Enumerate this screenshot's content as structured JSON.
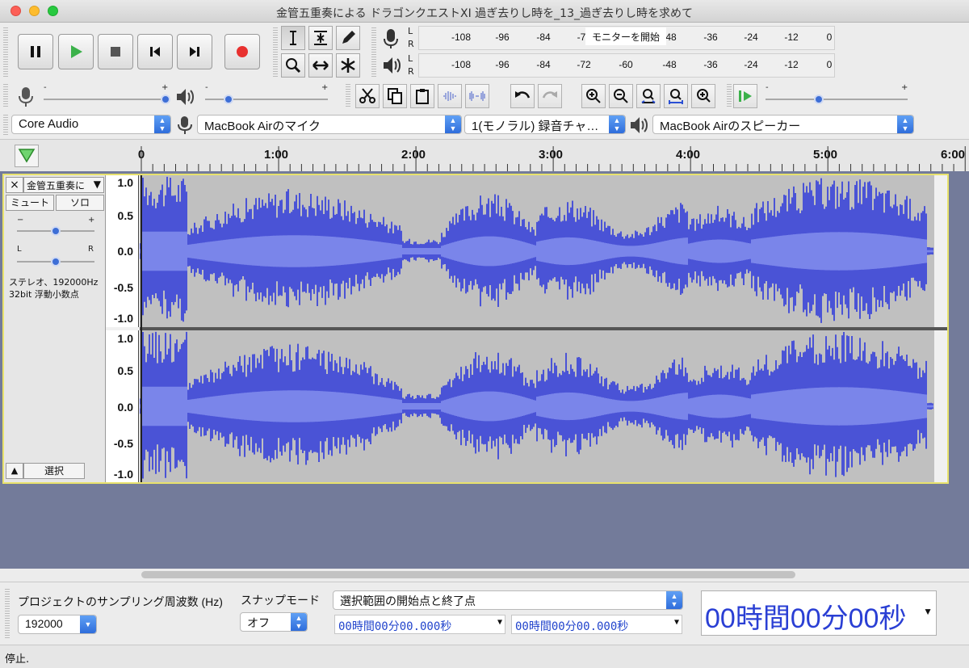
{
  "window": {
    "title": "金管五重奏による ドラゴンクエストXI 過ぎ去りし時を_13_過ぎ去りし時を求めて"
  },
  "transport": {
    "buttons": [
      {
        "id": "pause",
        "icon": "pause-icon"
      },
      {
        "id": "play",
        "icon": "play-icon"
      },
      {
        "id": "stop",
        "icon": "stop-icon"
      },
      {
        "id": "skip-start",
        "icon": "skip-to-start-icon"
      },
      {
        "id": "skip-end",
        "icon": "skip-to-end-icon"
      },
      {
        "id": "record",
        "icon": "record-icon"
      }
    ]
  },
  "meters": {
    "record": {
      "channels": [
        "L",
        "R"
      ],
      "ticks": [
        "-108",
        "-96",
        "-84",
        "-7",
        "-48",
        "-36",
        "-24",
        "-12",
        "0"
      ],
      "hint": "モニターを開始"
    },
    "playback": {
      "channels": [
        "L",
        "R"
      ],
      "ticks": [
        "-108",
        "-96",
        "-84",
        "-72",
        "-60",
        "-48",
        "-36",
        "-24",
        "-12",
        "0"
      ]
    }
  },
  "mixer": {
    "minus": "-",
    "plus": "+",
    "record_volume": 1.0,
    "playback_volume": 0.2
  },
  "play_at_speed": {
    "minus": "-",
    "plus": "+",
    "speed_position": 0.38
  },
  "devices": {
    "host": "Core Audio",
    "input": "MacBook Airのマイク",
    "channels": "1(モノラル) 録音チャ…",
    "output": "MacBook Airのスピーカー"
  },
  "timeline": {
    "labels": [
      "0",
      "1:00",
      "2:00",
      "3:00",
      "4:00",
      "5:00",
      "6:00"
    ]
  },
  "track": {
    "name": "金管五重奏に",
    "close": "×",
    "mute": "ミュート",
    "solo": "ソロ",
    "gain_minus": "−",
    "gain_plus": "+",
    "pan_left": "L",
    "pan_right": "R",
    "info_line1": "ステレオ、192000Hz",
    "info_line2": "32bit 浮動小数点",
    "collapse": "▲",
    "select": "選択",
    "scale": [
      "1.0",
      "0.5",
      "0.0",
      "-0.5",
      "-1.0"
    ]
  },
  "selection_toolbar": {
    "rate_label": "プロジェクトのサンプリング周波数 (Hz)",
    "rate_value": "192000",
    "snap_label": "スナップモード",
    "snap_value": "オフ",
    "mode_value": "選択範囲の開始点と終了点",
    "start_time": "00時間00分00.000秒",
    "end_time": "00時間00分00.000秒",
    "audio_position": "00時間00分00秒"
  },
  "status": {
    "text": "停止."
  },
  "colors": {
    "wave_peak": "#4a53d6",
    "wave_rms": "#7a85ea",
    "wave_bg": "#c0c0c0",
    "track_border": "#e8e26d",
    "background": "#737b9a"
  }
}
